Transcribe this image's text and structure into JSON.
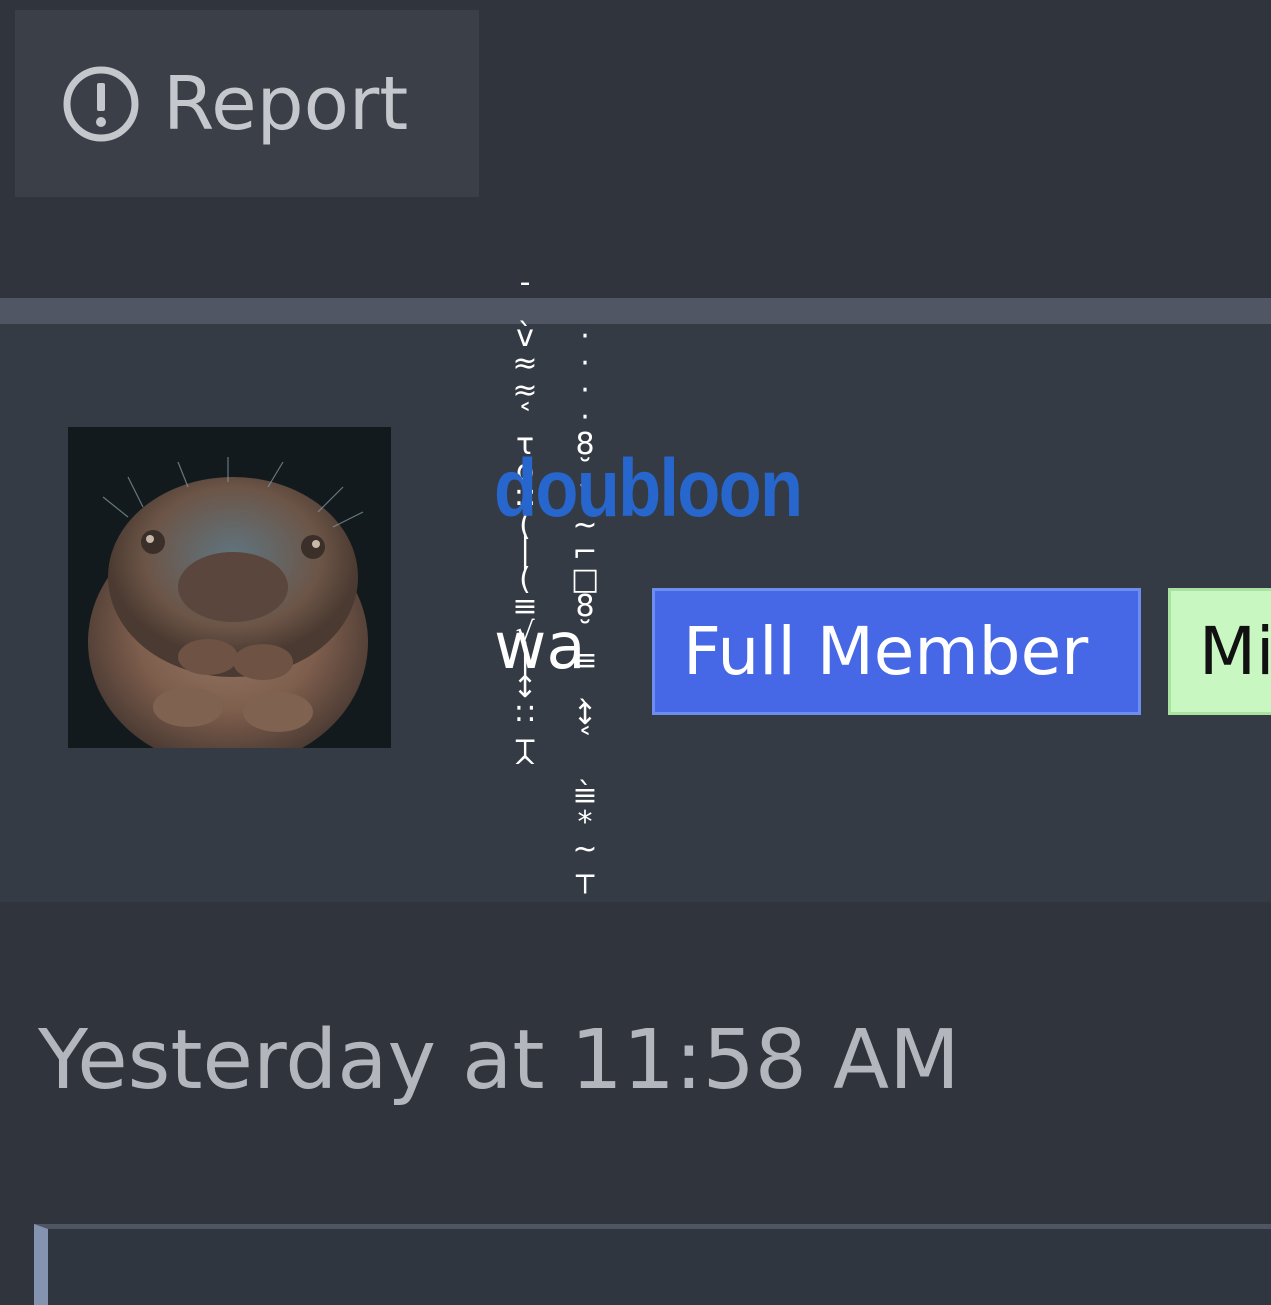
{
  "toolbar": {
    "report_label": "Report",
    "report_icon": "alert-circle-icon"
  },
  "user": {
    "name": "doubloon",
    "title": "wa",
    "avatar_icon": "tardigrade-avatar",
    "badges": [
      {
        "label": "Full Member",
        "color": "#4667e6"
      },
      {
        "label": "Mi",
        "color": "#c8f7c1"
      }
    ]
  },
  "post": {
    "timestamp": "Yesterday at 11:58 AM"
  },
  "decoration": {
    "zalgo_col1": [
      "-",
      "ˎ",
      "v",
      "≈",
      "≈",
      "˂",
      "τ",
      "o",
      "∷",
      "(",
      "│",
      "(",
      "≡",
      "√",
      "│",
      "↕",
      "∷",
      "┬",
      "^"
    ],
    "zalgo_col2": [
      "·",
      "·",
      "·",
      "·",
      "8",
      "˘",
      "˘",
      "~",
      "⌐",
      "□",
      "8",
      "˘",
      "≡",
      "ˎ",
      "↕",
      "˂",
      "ˎ",
      "≡",
      "*",
      "~",
      "┬"
    ]
  }
}
